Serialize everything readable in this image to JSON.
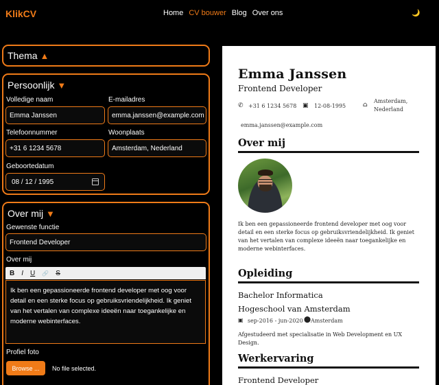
{
  "nav": {
    "brand": "KlikCV",
    "links": [
      "Home",
      "CV bouwer",
      "Blog",
      "Over ons"
    ]
  },
  "colors": {
    "accent": "#f07b18",
    "background": "#000000"
  },
  "sections": {
    "thema": {
      "title": "Thema",
      "arrow": "▲"
    },
    "persoonlijk": {
      "title": "Persoonlijk",
      "arrow": "▼",
      "fields": {
        "name_label": "Volledige naam",
        "name_value": "Emma Janssen",
        "email_label": "E-mailadres",
        "email_value": "emma.janssen@example.com",
        "phone_label": "Telefoonnummer",
        "phone_value": "+31 6 1234 5678",
        "city_label": "Woonplaats",
        "city_value": "Amsterdam, Nederland",
        "dob_label": "Geboortedatum",
        "dob_value": "08 / 12 / 1995"
      }
    },
    "overmij": {
      "title": "Over mij",
      "arrow": "▼",
      "job_label": "Gewenste functie",
      "job_value": "Frontend Developer",
      "about_label": "Over mij",
      "toolbar": [
        "B",
        "I",
        "U",
        "🔗",
        "S"
      ],
      "about_text": "Ik ben een gepassioneerde frontend developer met oog voor detail en een sterke focus op gebruiksvriendelijkheid. Ik geniet van het vertalen van complexe ideeën naar toegankelijke en moderne webinterfaces.",
      "photo_label": "Profiel foto",
      "browse_label": "Browse ...",
      "nofile": "No file selected."
    }
  },
  "cv": {
    "name": "Emma Janssen",
    "role": "Frontend Developer",
    "phone": "+31 6 1234 5678",
    "dob": "12-08-1995",
    "city_line1": "Amsterdam,",
    "city_line2": "Nederland",
    "email": "emma.janssen@example.com",
    "about_heading": "Over mij",
    "about_text": "Ik ben een gepassioneerde frontend developer met oog voor detail en een sterke focus op gebruiksvriendelijkheid. Ik geniet van het vertalen van complexe ideeën naar toegankelijke en moderne webinterfaces.",
    "edu_heading": "Opleiding",
    "edu_title": "Bachelor Informatica",
    "edu_school": "Hogeschool van Amsterdam",
    "edu_dates": "sep-2016 - jun-2020",
    "edu_city": "Amsterdam",
    "edu_desc": "Afgestudeerd met specialisatie in Web Development en UX Design.",
    "work_heading": "Werkervaring",
    "work_title": "Frontend Developer"
  }
}
